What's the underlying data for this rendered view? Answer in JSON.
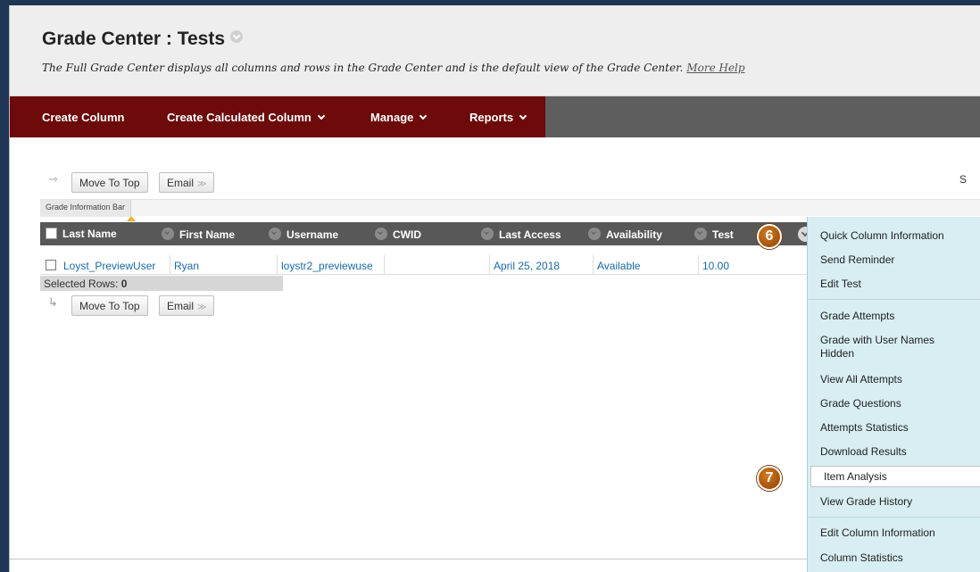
{
  "page": {
    "title": "Grade Center : Tests",
    "subtitle": "The Full Grade Center displays all columns and rows in the Grade Center and is the default view of the Grade Center.",
    "help_link": "More Help"
  },
  "nav": {
    "create_column": "Create Column",
    "create_calculated_column": "Create Calculated Column",
    "manage": "Manage",
    "reports": "Reports"
  },
  "toolbar": {
    "move_to_top": "Move To Top",
    "email": "Email",
    "grade_info_bar": "Grade Information Bar",
    "partial_label": "S"
  },
  "grid": {
    "columns": [
      "Last Name",
      "First Name",
      "Username",
      "CWID",
      "Last Access",
      "Availability",
      "Test"
    ],
    "row": {
      "last_name": "Loyst_PreviewUser",
      "first_name": "Ryan",
      "username": "loystr2_previewuse",
      "cwid": "",
      "last_access": "April 25, 2018",
      "availability": "Available",
      "test": "10.00"
    },
    "selected_rows_label": "Selected Rows:",
    "selected_rows_count": "0"
  },
  "menu": {
    "items": [
      "Quick Column Information",
      "Send Reminder",
      "Edit Test",
      "Grade Attempts",
      "Grade with User Names Hidden",
      "View All Attempts",
      "Grade Questions",
      "Attempts Statistics",
      "Download Results",
      "Item Analysis",
      "View Grade History",
      "Edit Column Information",
      "Column Statistics"
    ]
  },
  "badges": {
    "step_6": "6",
    "step_7": "7"
  },
  "colors": {
    "nav_maroon": "#6d0a0a",
    "menu_bg": "#d8eef3",
    "badge": "#b85c14"
  }
}
